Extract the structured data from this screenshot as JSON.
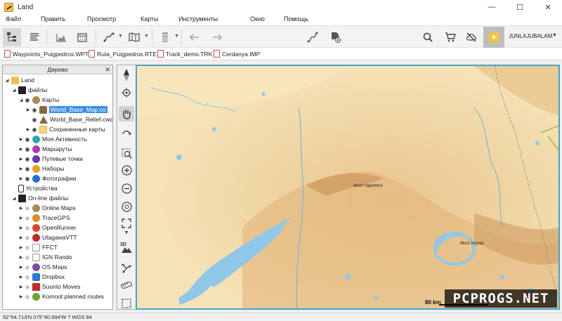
{
  "window": {
    "title": "Land",
    "minimize": "—",
    "maximize": "☐",
    "close": "✕"
  },
  "menu": [
    "Файл",
    "Править",
    "Просмотр",
    "Карты",
    "Инструменты",
    "Окно",
    "Помощь"
  ],
  "account": {
    "username": "JUNLAJUBALAM"
  },
  "file_tabs": [
    "Waypoints_Puigpedros.WPT",
    "Ruta_Puigpedros.RTE",
    "Track_demo.TRK",
    "Cerdanya.IMP"
  ],
  "tree": {
    "header": "Дерево",
    "close": "✕",
    "items": [
      {
        "label": "Land"
      },
      {
        "label": "файлы"
      },
      {
        "label": "Карты"
      },
      {
        "label": "World_Base_Map.co"
      },
      {
        "label": "World_Base_Relief.cwd"
      },
      {
        "label": "Сохраненные карты"
      },
      {
        "label": "Моя Активность"
      },
      {
        "label": "Маршруты"
      },
      {
        "label": "Путевые точки"
      },
      {
        "label": "Наборы"
      },
      {
        "label": "Фотографии"
      },
      {
        "label": "Устройства"
      },
      {
        "label": "On-line файлы"
      },
      {
        "label": "Online Maps"
      },
      {
        "label": "TraceGPS"
      },
      {
        "label": "OpenRunner"
      },
      {
        "label": "UtagawaVTT"
      },
      {
        "label": "FFCT"
      },
      {
        "label": "IGN Rando"
      },
      {
        "label": "OS Maps"
      },
      {
        "label": "Dropbox"
      },
      {
        "label": "Suunto Moves"
      },
      {
        "label": "Komoot planned routes"
      }
    ]
  },
  "map": {
    "labels": {
      "yaprehtso": "Mont Yaprehtso",
      "veyrier": "Mont Veyrier"
    },
    "scale": "80 km",
    "watermark": "PCPROGS.NET"
  },
  "status": {
    "text": "52°54.713'N 075°40.994'W  ?  WGS 84"
  },
  "colors": {
    "accent": "#3a8ee6",
    "map_border": "#43a6c8",
    "water": "#8fc8e8",
    "land": "#f2d9a6"
  }
}
